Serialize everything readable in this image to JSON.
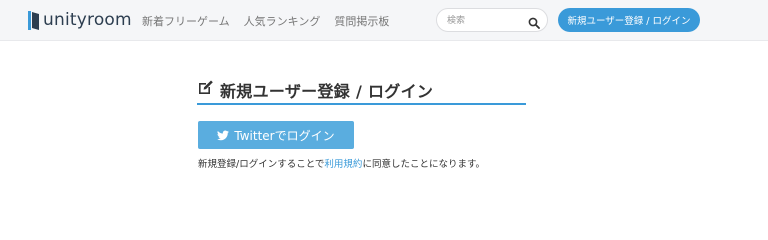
{
  "header": {
    "logo_text": "unityroom",
    "nav": [
      {
        "label": "新着フリーゲーム"
      },
      {
        "label": "人気ランキング"
      },
      {
        "label": "質問掲示板"
      }
    ],
    "search_placeholder": "検索",
    "signup_button": "新規ユーザー登録 / ログイン"
  },
  "main": {
    "title": "新規ユーザー登録 / ログイン",
    "twitter_button": "Twitterでログイン",
    "notice_before": "新規登録/ログインすることで",
    "notice_link": "利用規約",
    "notice_after": "に同意したことになります。"
  },
  "colors": {
    "accent": "#3a9ad9",
    "twitter": "#5aaddf",
    "header_bg": "#f5f6f8"
  },
  "icons": {
    "logo": "unityroom-logo-icon",
    "search": "search-icon",
    "title": "edit-icon",
    "twitter": "twitter-bird-icon"
  }
}
